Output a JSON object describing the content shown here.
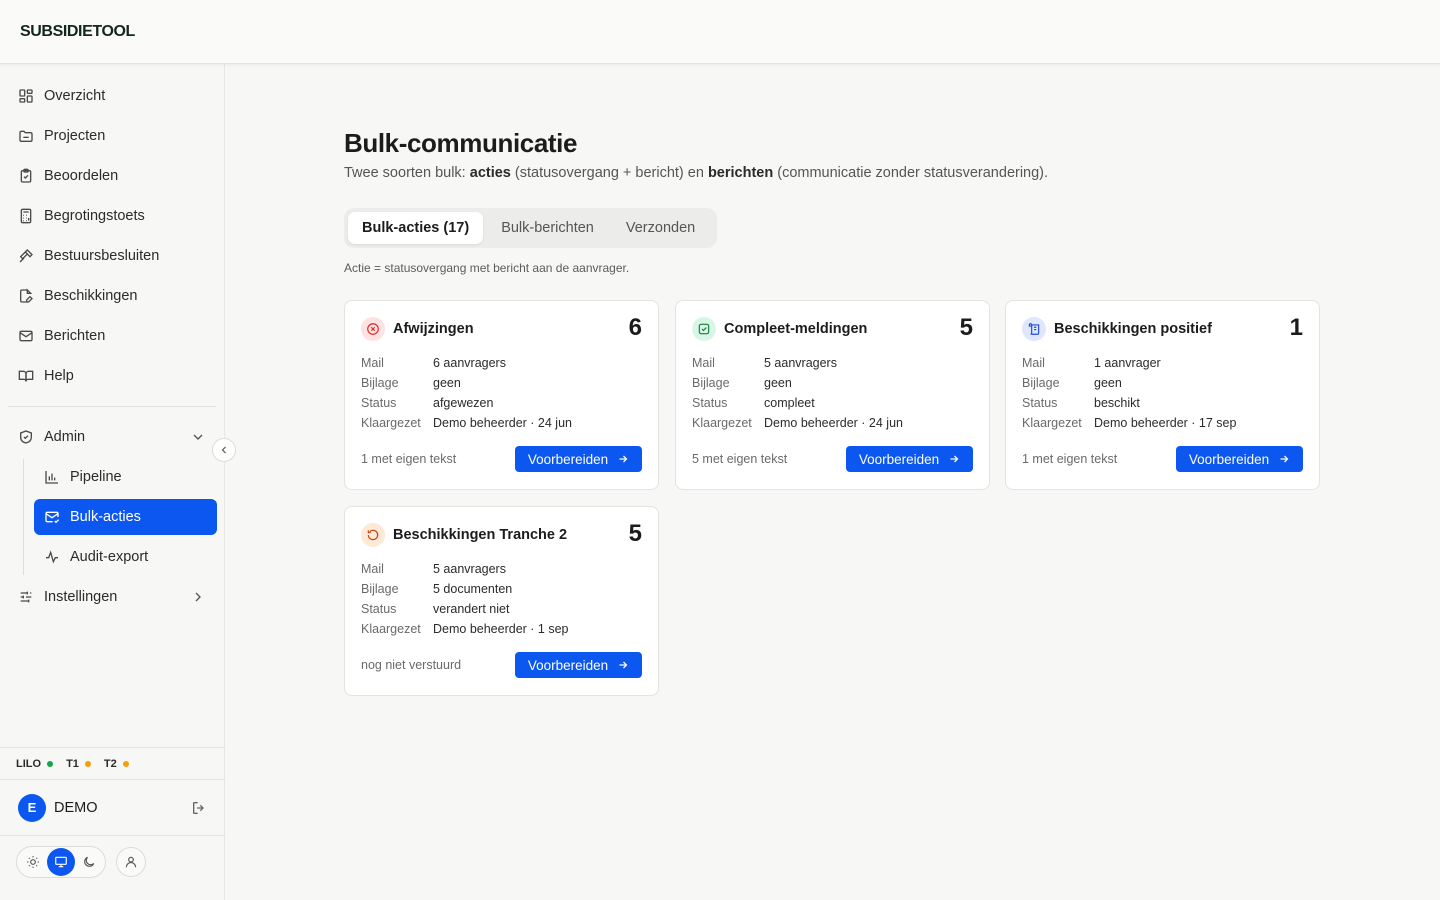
{
  "app": {
    "brand": "SUBSIDIETOOL"
  },
  "sidebar": {
    "items": [
      {
        "label": "Overzicht",
        "icon": "dashboard-icon"
      },
      {
        "label": "Projecten",
        "icon": "folder-icon"
      },
      {
        "label": "Beoordelen",
        "icon": "clipboard-check-icon"
      },
      {
        "label": "Begrotingstoets",
        "icon": "calculator-icon"
      },
      {
        "label": "Bestuursbesluiten",
        "icon": "gavel-icon"
      },
      {
        "label": "Beschikkingen",
        "icon": "file-edit-icon"
      },
      {
        "label": "Berichten",
        "icon": "mail-icon"
      },
      {
        "label": "Help",
        "icon": "book-icon"
      }
    ],
    "admin": {
      "label": "Admin",
      "children": [
        {
          "label": "Pipeline",
          "icon": "bar-chart-icon"
        },
        {
          "label": "Bulk-acties",
          "icon": "mail-check-icon",
          "active": true
        },
        {
          "label": "Audit-export",
          "icon": "activity-icon"
        }
      ]
    },
    "settings": {
      "label": "Instellingen"
    },
    "environments": [
      {
        "label": "LILO",
        "color": "#16a34a"
      },
      {
        "label": "T1",
        "color": "#f59e0b"
      },
      {
        "label": "T2",
        "color": "#f59e0b"
      }
    ],
    "user": {
      "initial": "E",
      "name": "DEMO"
    }
  },
  "page": {
    "title": "Bulk-communicatie",
    "subtitle": {
      "p1": "Twee soorten bulk: ",
      "b1": "acties",
      "p2": " (statusovergang + bericht) en ",
      "b2": "berichten",
      "p3": " (communicatie zonder statusverandering)."
    },
    "tabs": [
      {
        "label": "Bulk-acties (17)",
        "active": true
      },
      {
        "label": "Bulk-berichten"
      },
      {
        "label": "Verzonden"
      }
    ],
    "hint": "Actie = statusovergang met bericht aan de aanvrager."
  },
  "meta_labels": {
    "mail": "Mail",
    "bijlage": "Bijlage",
    "status": "Status",
    "klaargezet": "Klaargezet"
  },
  "cards": [
    {
      "title": "Afwijzingen",
      "count": "6",
      "mail": "6 aanvragers",
      "bijlage": "geen",
      "status": "afgewezen",
      "klaargezet": "Demo beheerder · 24 jun",
      "foot": "1 met eigen tekst",
      "button": "Voorbereiden",
      "icon": "x-circle-icon",
      "badge_bg": "#fde2e2",
      "badge_fg": "#dc2626"
    },
    {
      "title": "Compleet-meldingen",
      "count": "5",
      "mail": "5 aanvragers",
      "bijlage": "geen",
      "status": "compleet",
      "klaargezet": "Demo beheerder · 24 jun",
      "foot": "5 met eigen tekst",
      "button": "Voorbereiden",
      "icon": "check-square-icon",
      "badge_bg": "#d9f5e5",
      "badge_fg": "#15803d"
    },
    {
      "title": "Beschikkingen positief",
      "count": "1",
      "mail": "1 aanvrager",
      "bijlage": "geen",
      "status": "beschikt",
      "klaargezet": "Demo beheerder · 17 sep",
      "foot": "1 met eigen tekst",
      "button": "Voorbereiden",
      "icon": "scroll-icon",
      "badge_bg": "#dfe6fd",
      "badge_fg": "#1d4ed8"
    },
    {
      "title": "Beschikkingen Tranche 2",
      "count": "5",
      "mail": "5 aanvragers",
      "bijlage": "5 documenten",
      "status": "verandert niet",
      "klaargezet": "Demo beheerder · 1 sep",
      "foot": "nog niet verstuurd",
      "button": "Voorbereiden",
      "icon": "rotate-icon",
      "badge_bg": "#fde9d6",
      "badge_fg": "#c2410c"
    }
  ],
  "colors": {
    "accent": "#0b57f0"
  }
}
